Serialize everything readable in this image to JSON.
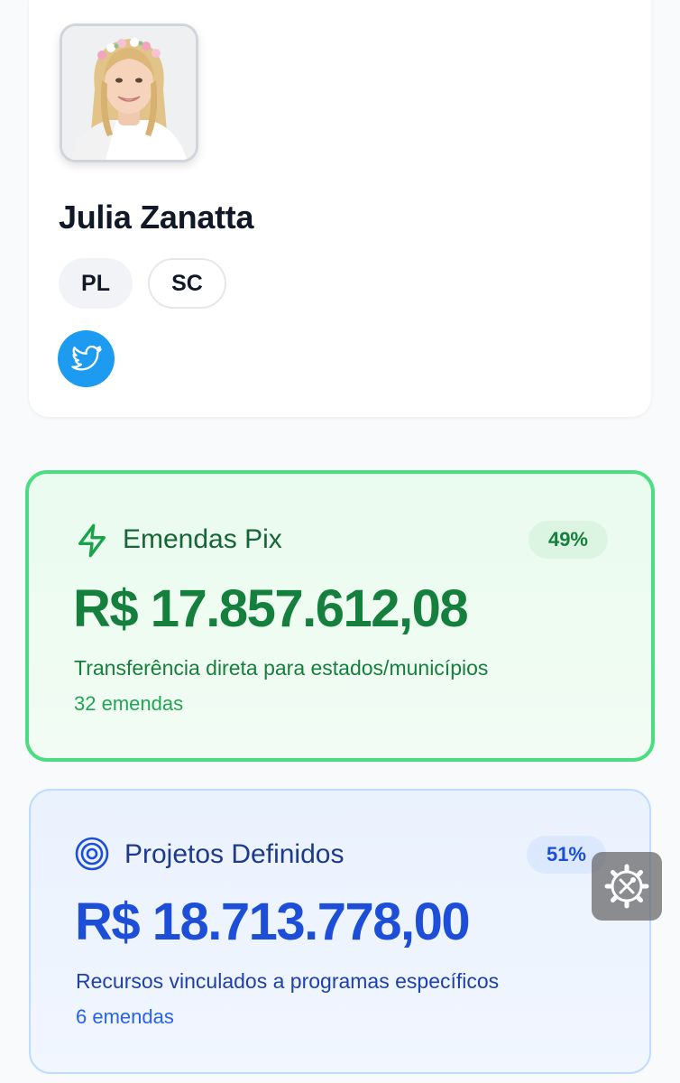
{
  "profile": {
    "name": "Julia Zanatta",
    "party": "PL",
    "state": "SC",
    "photo_icon": "politician-portrait",
    "social_icon": "twitter-icon"
  },
  "cards": {
    "pix": {
      "title": "Emendas Pix",
      "percent": "49%",
      "amount": "R$ 17.857.612,08",
      "description": "Transferência direta para estados/municípios",
      "count": "32 emendas",
      "icon": "lightning-icon",
      "accent_color": "#15803d"
    },
    "projects": {
      "title": "Projetos Definidos",
      "percent": "51%",
      "amount": "R$ 18.713.778,00",
      "description": "Recursos vinculados a programas específicos",
      "count": "6 emendas",
      "icon": "target-icon",
      "accent_color": "#1d4ed8"
    }
  },
  "overlay": {
    "icon": "settings-tools-icon"
  }
}
